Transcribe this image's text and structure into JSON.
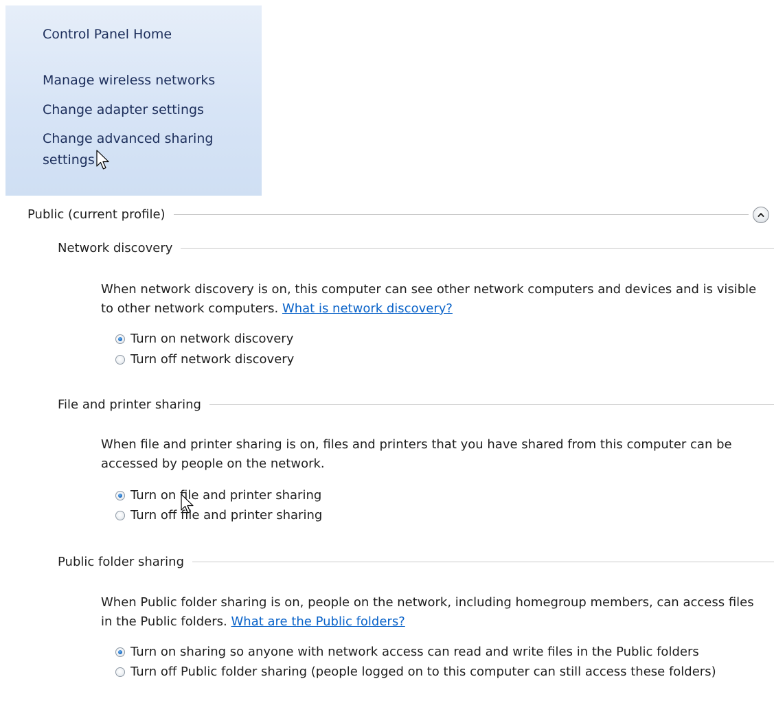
{
  "nav": {
    "home": "Control Panel Home",
    "items": [
      "Manage wireless networks",
      "Change adapter settings",
      "Change advanced sharing",
      "settings"
    ]
  },
  "profile": {
    "title": "Public (current profile)",
    "collapse_icon": "chevron-up-icon"
  },
  "sections": {
    "discovery": {
      "title": "Network discovery",
      "description": "When network discovery is on, this computer can see other network computers and devices and is visible to other network computers.",
      "link": "What is network discovery?",
      "options": [
        {
          "label": "Turn on network discovery",
          "checked": true
        },
        {
          "label": "Turn off network discovery",
          "checked": false
        }
      ]
    },
    "file_sharing": {
      "title": "File and printer sharing",
      "description": "When file and printer sharing is on, files and printers that you have shared from this computer can be accessed by people on the network.",
      "options": [
        {
          "label": "Turn on file and printer sharing",
          "checked": true
        },
        {
          "label": "Turn off file and printer sharing",
          "checked": false
        }
      ]
    },
    "public_folder": {
      "title": "Public folder sharing",
      "description": "When Public folder sharing is on, people on the network, including homegroup members, can access files in the Public folders.",
      "link": "What are the Public folders?",
      "options": [
        {
          "label": "Turn on sharing so anyone with network access can read and write files in the Public folders",
          "checked": true
        },
        {
          "label": "Turn off Public folder sharing (people logged on to this computer can still access these folders)",
          "checked": false
        }
      ]
    }
  },
  "colors": {
    "nav_background": "#d7e4f6",
    "link": "#0a63c9",
    "nav_text": "#1b2d5a",
    "radio_selected": "#1f6fc4"
  }
}
